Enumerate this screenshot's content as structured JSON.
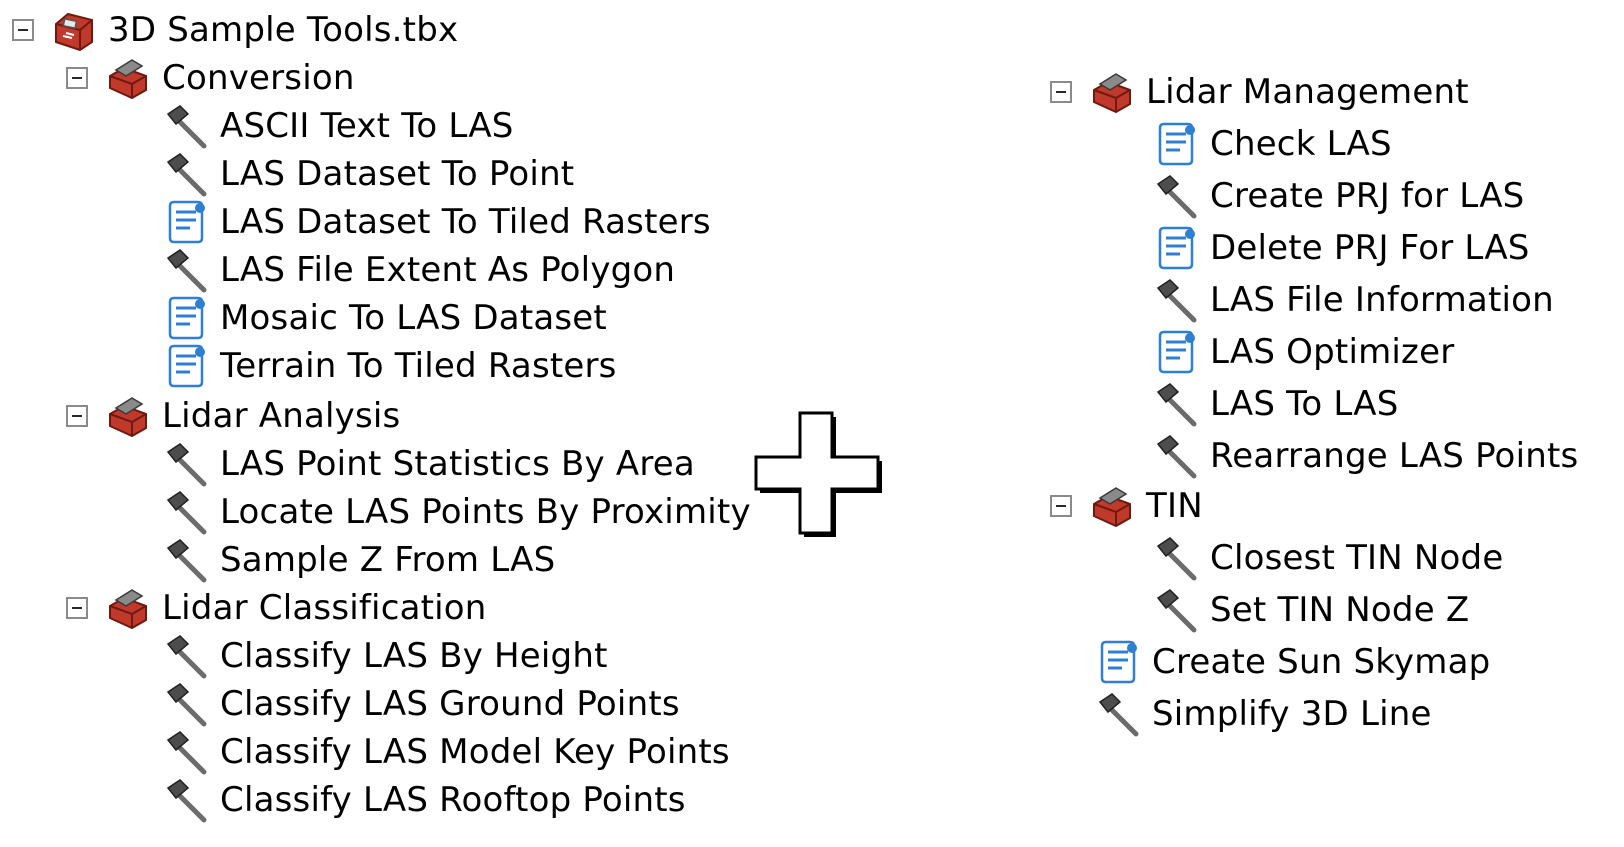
{
  "left_tree": {
    "root": {
      "label": "3D Sample Tools.tbx",
      "icon": "toolbox-file-icon"
    },
    "conversion": {
      "label": "Conversion",
      "icon": "toolset-icon",
      "items": [
        {
          "label": "ASCII Text To LAS",
          "icon": "hammer-tool-icon"
        },
        {
          "label": "LAS Dataset To Point",
          "icon": "hammer-tool-icon"
        },
        {
          "label": "LAS Dataset To Tiled Rasters",
          "icon": "script-tool-icon"
        },
        {
          "label": "LAS File Extent As Polygon",
          "icon": "hammer-tool-icon"
        },
        {
          "label": "Mosaic To LAS Dataset",
          "icon": "script-tool-icon"
        },
        {
          "label": "Terrain To Tiled Rasters",
          "icon": "script-tool-icon"
        }
      ]
    },
    "lidar_analysis": {
      "label": "Lidar Analysis",
      "icon": "toolset-icon",
      "items": [
        {
          "label": "LAS Point Statistics By Area",
          "icon": "hammer-tool-icon"
        },
        {
          "label": "Locate LAS Points By Proximity",
          "icon": "hammer-tool-icon"
        },
        {
          "label": "Sample Z From LAS",
          "icon": "hammer-tool-icon"
        }
      ]
    },
    "lidar_classification": {
      "label": "Lidar Classification",
      "icon": "toolset-icon",
      "items": [
        {
          "label": "Classify LAS By Height",
          "icon": "hammer-tool-icon"
        },
        {
          "label": "Classify LAS Ground Points",
          "icon": "hammer-tool-icon"
        },
        {
          "label": "Classify LAS Model Key Points",
          "icon": "hammer-tool-icon"
        },
        {
          "label": "Classify LAS Rooftop Points",
          "icon": "hammer-tool-icon"
        }
      ]
    }
  },
  "right_tree": {
    "lidar_management": {
      "label": "Lidar Management",
      "icon": "toolset-icon",
      "items": [
        {
          "label": "Check LAS",
          "icon": "script-tool-icon"
        },
        {
          "label": "Create PRJ for LAS",
          "icon": "hammer-tool-icon"
        },
        {
          "label": "Delete PRJ For LAS",
          "icon": "script-tool-icon"
        },
        {
          "label": "LAS File Information",
          "icon": "hammer-tool-icon"
        },
        {
          "label": "LAS Optimizer",
          "icon": "script-tool-icon"
        },
        {
          "label": "LAS To LAS",
          "icon": "hammer-tool-icon"
        },
        {
          "label": "Rearrange LAS Points",
          "icon": "hammer-tool-icon"
        }
      ]
    },
    "tin": {
      "label": "TIN",
      "icon": "toolset-icon",
      "items": [
        {
          "label": "Closest TIN Node",
          "icon": "hammer-tool-icon"
        },
        {
          "label": "Set TIN Node Z",
          "icon": "hammer-tool-icon"
        }
      ]
    },
    "loose_items": [
      {
        "label": "Create Sun Skymap",
        "icon": "script-tool-icon"
      },
      {
        "label": "Simplify 3D Line",
        "icon": "hammer-tool-icon"
      }
    ]
  },
  "connector": {
    "icon": "plus-sign-icon"
  },
  "colors": {
    "toolbox_red": "#c0392b",
    "script_blue": "#2f7fd4",
    "hammer_gray": "#6b6b6b",
    "expander_border": "#8a8a8a"
  }
}
